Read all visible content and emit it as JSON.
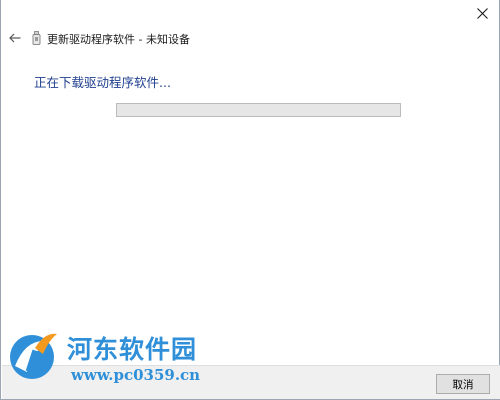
{
  "window": {
    "title": "更新驱动程序软件 - 未知设备",
    "close_icon": "close-icon",
    "back_icon": "back-arrow-icon",
    "device_icon": "usb-device-icon"
  },
  "main": {
    "status_text": "正在下载驱动程序软件...",
    "progress": {
      "value": 0,
      "unit": "percent"
    }
  },
  "footer": {
    "cancel_label": "取消"
  },
  "watermark": {
    "name": "河东软件园",
    "url": "www.pc0359.cn",
    "colors": {
      "primary": "#2f8fd8",
      "accent": "#f39a1e"
    }
  },
  "colors": {
    "status_text": "#1f3f8f",
    "progress_track": "#e6e6e6",
    "footer_bg": "#f0f0f0"
  }
}
